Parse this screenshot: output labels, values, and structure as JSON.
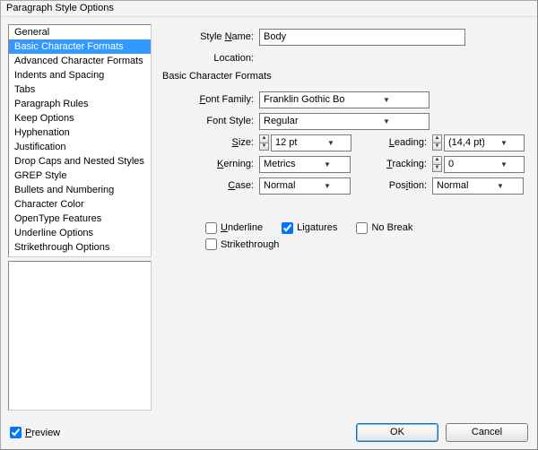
{
  "window": {
    "title": "Paragraph Style Options"
  },
  "sidebar": {
    "items": [
      "General",
      "Basic Character Formats",
      "Advanced Character Formats",
      "Indents and Spacing",
      "Tabs",
      "Paragraph Rules",
      "Keep Options",
      "Hyphenation",
      "Justification",
      "Drop Caps and Nested Styles",
      "GREP Style",
      "Bullets and Numbering",
      "Character Color",
      "OpenType Features",
      "Underline Options",
      "Strikethrough Options"
    ],
    "selected_index": 1
  },
  "form": {
    "style_name_label": "Style Name:",
    "style_name_value": "Body",
    "location_label": "Location:",
    "section_title": "Basic Character Formats",
    "font_family_label": "Font Family:",
    "font_family_value": "Franklin Gothic Book",
    "font_style_label": "Font Style:",
    "font_style_value": "Regular",
    "size_label": "Size:",
    "size_value": "12 pt",
    "leading_label": "Leading:",
    "leading_value": "(14,4 pt)",
    "kerning_label": "Kerning:",
    "kerning_value": "Metrics",
    "tracking_label": "Tracking:",
    "tracking_value": "0",
    "case_label": "Case:",
    "case_value": "Normal",
    "position_label": "Position:",
    "position_value": "Normal"
  },
  "checks": {
    "underline_label": "Underline",
    "underline_checked": false,
    "ligatures_label": "Ligatures",
    "ligatures_checked": true,
    "nobreak_label": "No Break",
    "nobreak_checked": false,
    "strike_label": "Strikethrough",
    "strike_checked": false
  },
  "footer": {
    "preview_label": "Preview",
    "preview_checked": true,
    "ok_label": "OK",
    "cancel_label": "Cancel"
  }
}
